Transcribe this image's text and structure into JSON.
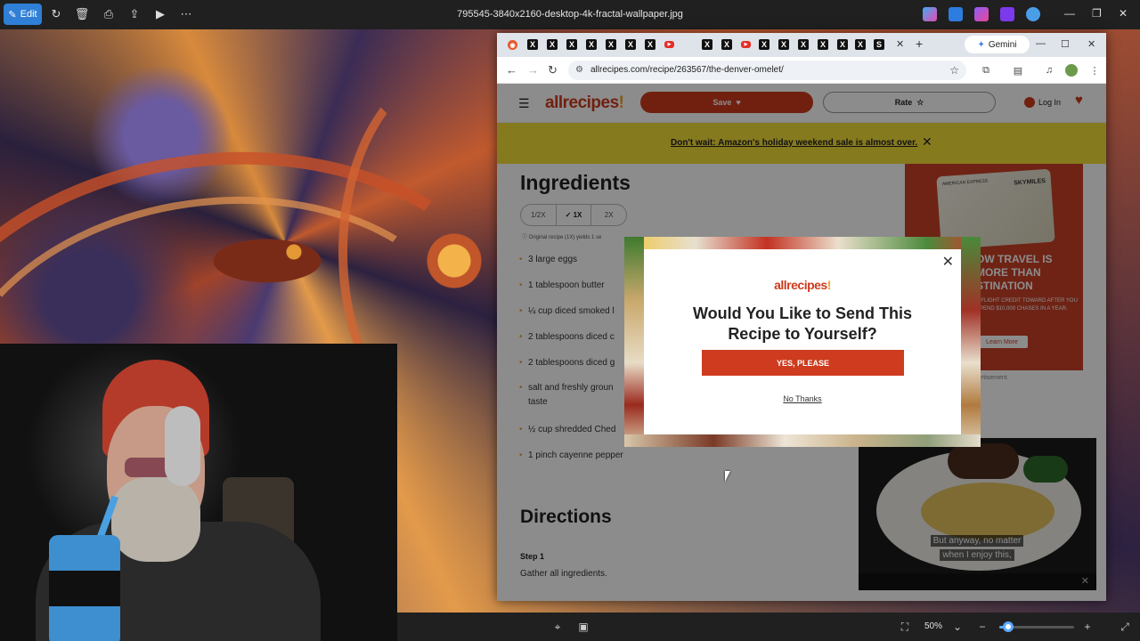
{
  "viewer": {
    "edit_label": "Edit",
    "file_name": "795545-3840x2160-desktop-4k-fractal-wallpaper.jpg",
    "zoom_label": "50%",
    "zoom_level": 0.12
  },
  "browser": {
    "gemini_label": "Gemini",
    "url": "allrecipes.com/recipe/263567/the-denver-omelet/"
  },
  "site": {
    "logo": "allrecipes",
    "save_label": "Save",
    "rate_label": "Rate",
    "login_label": "Log In",
    "promo_text": "Don't wait: Amazon's holiday weekend sale is almost over."
  },
  "recipe": {
    "ingredients_heading": "Ingredients",
    "scale_options": [
      "1/2X",
      "✓ 1X",
      "2X"
    ],
    "yield_text": "Original recipe (1X) yields 1 se",
    "ingredients": [
      "3 large eggs",
      "1 tablespoon butter",
      "¼ cup diced smoked l",
      "2 tablespoons diced c",
      "2 tablespoons diced g",
      "salt and freshly groun",
      "taste",
      "½ cup shredded Ched",
      "1 pinch cayenne pepper"
    ],
    "directions_heading": "Directions",
    "step_label": "Step 1",
    "step_text": "Gather all ingredients."
  },
  "ad": {
    "card_top": "AMERICAN EXPRESS",
    "card_brand": "SKYMILES",
    "headline": "OW TRAVEL IS MORE THAN STINATION",
    "small_text": "A FLIGHT CREDIT TOWARD AFTER YOU SPEND $10,000 CHASES IN A YEAR.",
    "button": "Learn More",
    "label": "Advertisement"
  },
  "video": {
    "caption_line1": "But anyway, no matter",
    "caption_line2": "when I enjoy this,"
  },
  "modal": {
    "logo": "allrecipes",
    "title_line1": "Would You Like to Send This",
    "title_line2": "Recipe to Yourself?",
    "yes_label": "YES, PLEASE",
    "no_label": "No Thanks"
  }
}
